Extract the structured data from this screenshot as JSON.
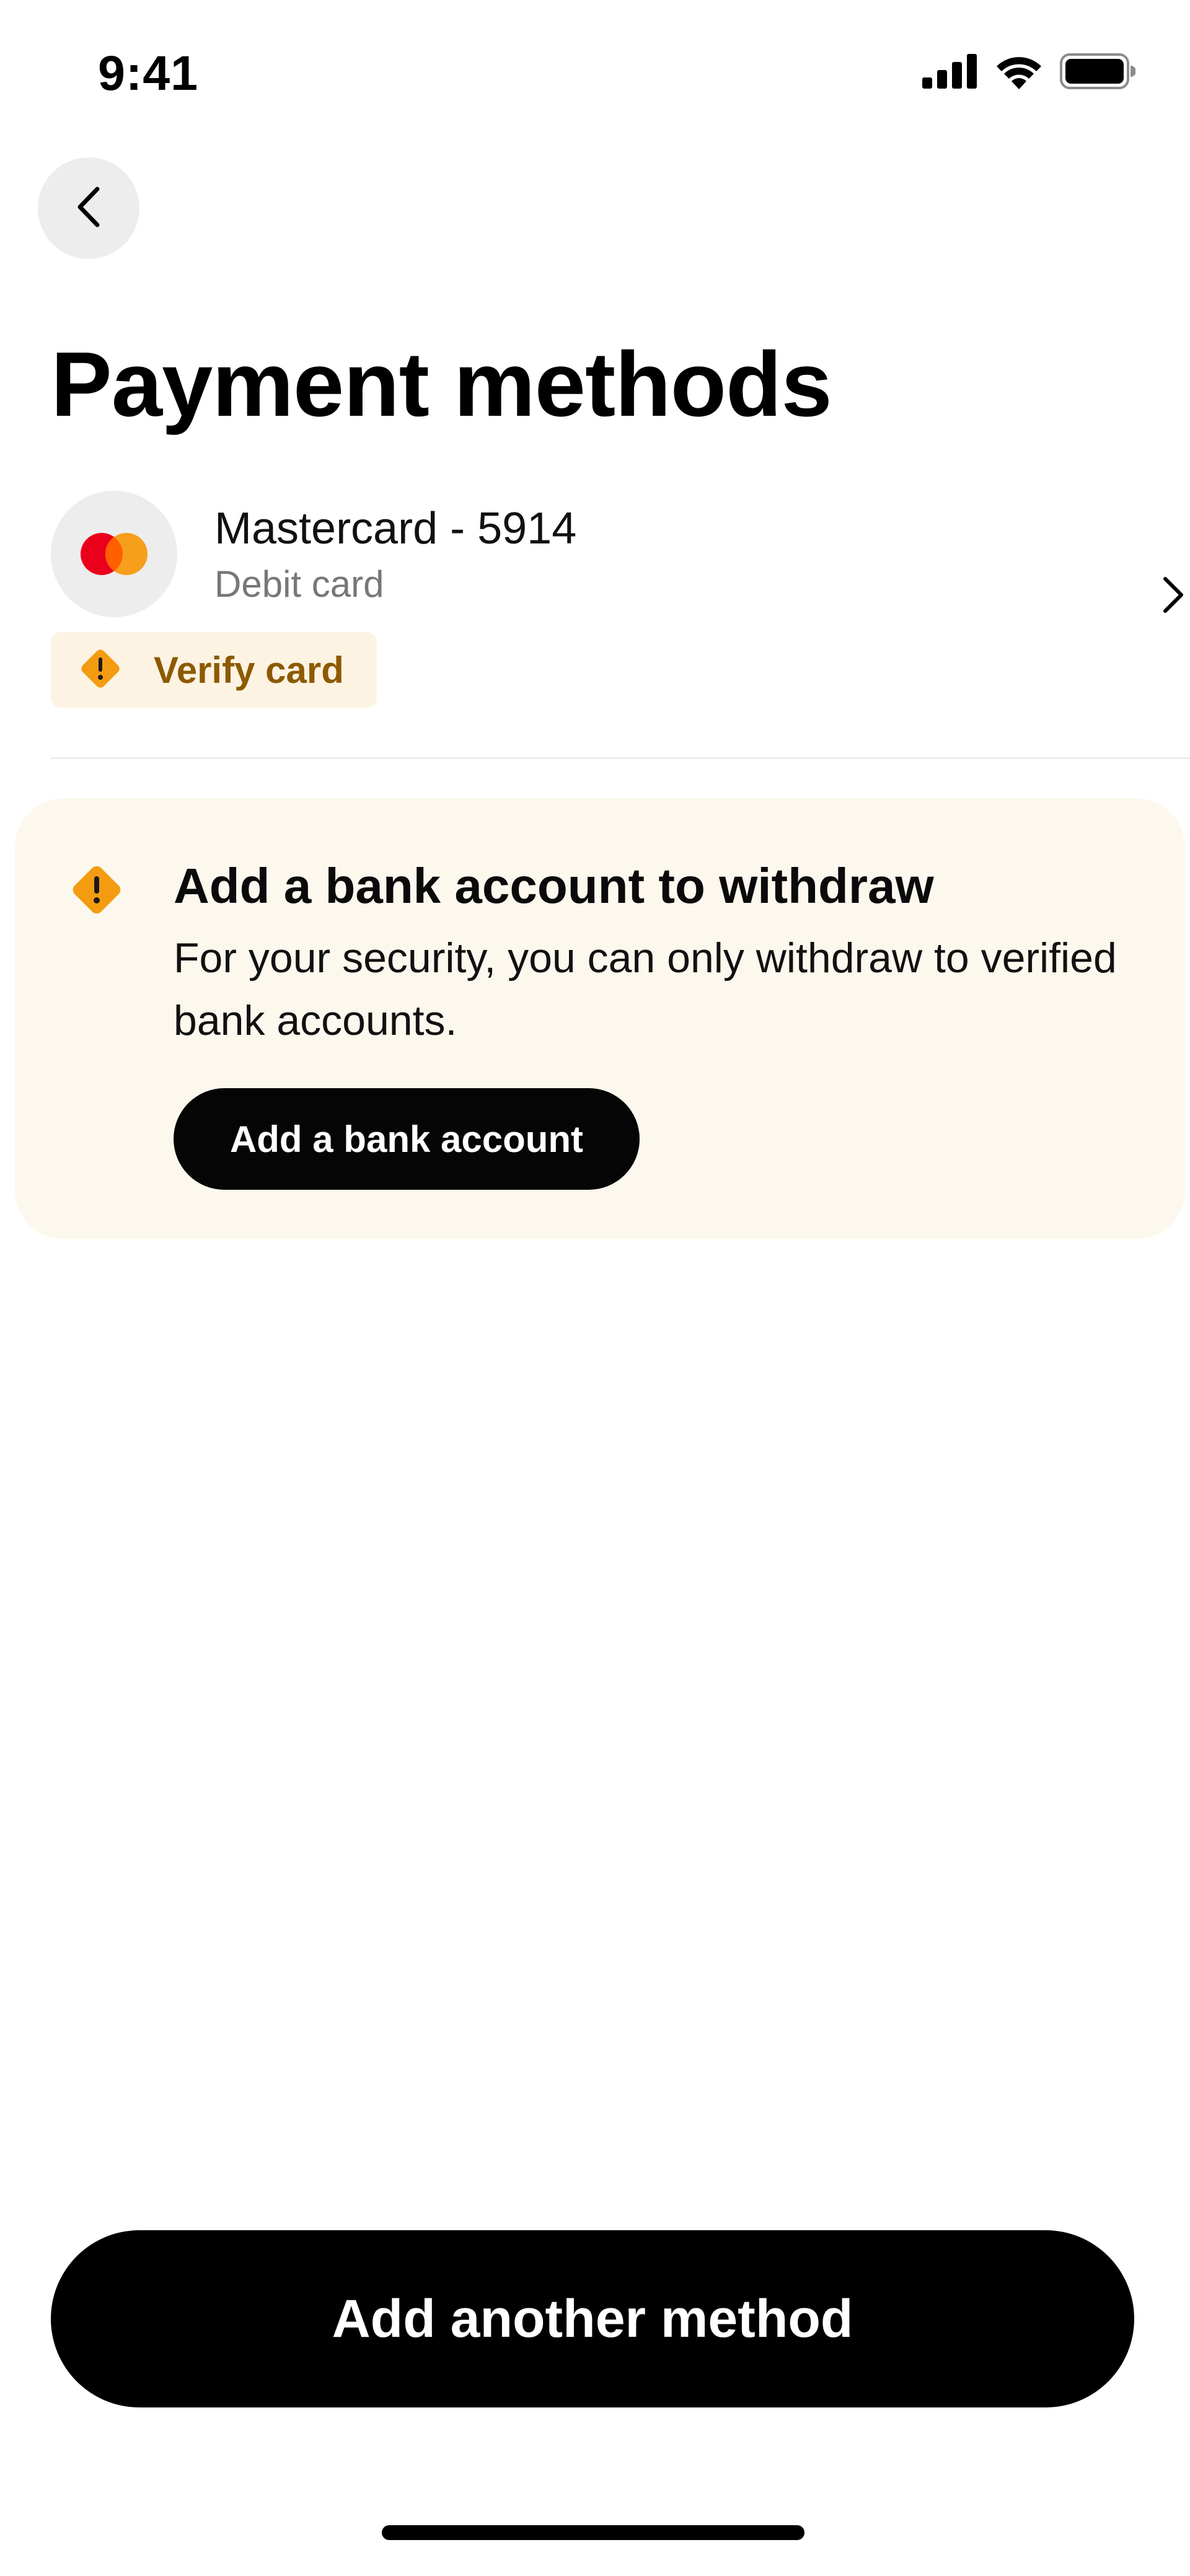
{
  "status_bar": {
    "time": "9:41",
    "icons": [
      "cellular-signal-icon",
      "wifi-icon",
      "battery-icon"
    ]
  },
  "nav": {
    "back_icon": "chevron-left-icon"
  },
  "page": {
    "title": "Payment methods"
  },
  "payment_methods": [
    {
      "logo_icon": "mastercard-logo-icon",
      "name": "Mastercard - 5914",
      "type": "Debit card",
      "status_badge": {
        "icon": "warning-diamond-icon",
        "label": "Verify card"
      },
      "chevron_icon": "chevron-right-icon"
    }
  ],
  "bank_notice": {
    "icon": "warning-diamond-icon",
    "title": "Add a bank account to withdraw",
    "body": "For your security, you can only withdraw to verified bank accounts.",
    "button_label": "Add a bank account"
  },
  "footer": {
    "add_method_label": "Add another method"
  },
  "colors": {
    "warning": "#f39c12",
    "warning_text": "#8c5a00",
    "badge_bg": "#fdf3e3",
    "notice_bg": "#fcf8ee",
    "mastercard_red": "#eb001b",
    "mastercard_orange": "#f79e1b",
    "primary_button": "#000000"
  }
}
